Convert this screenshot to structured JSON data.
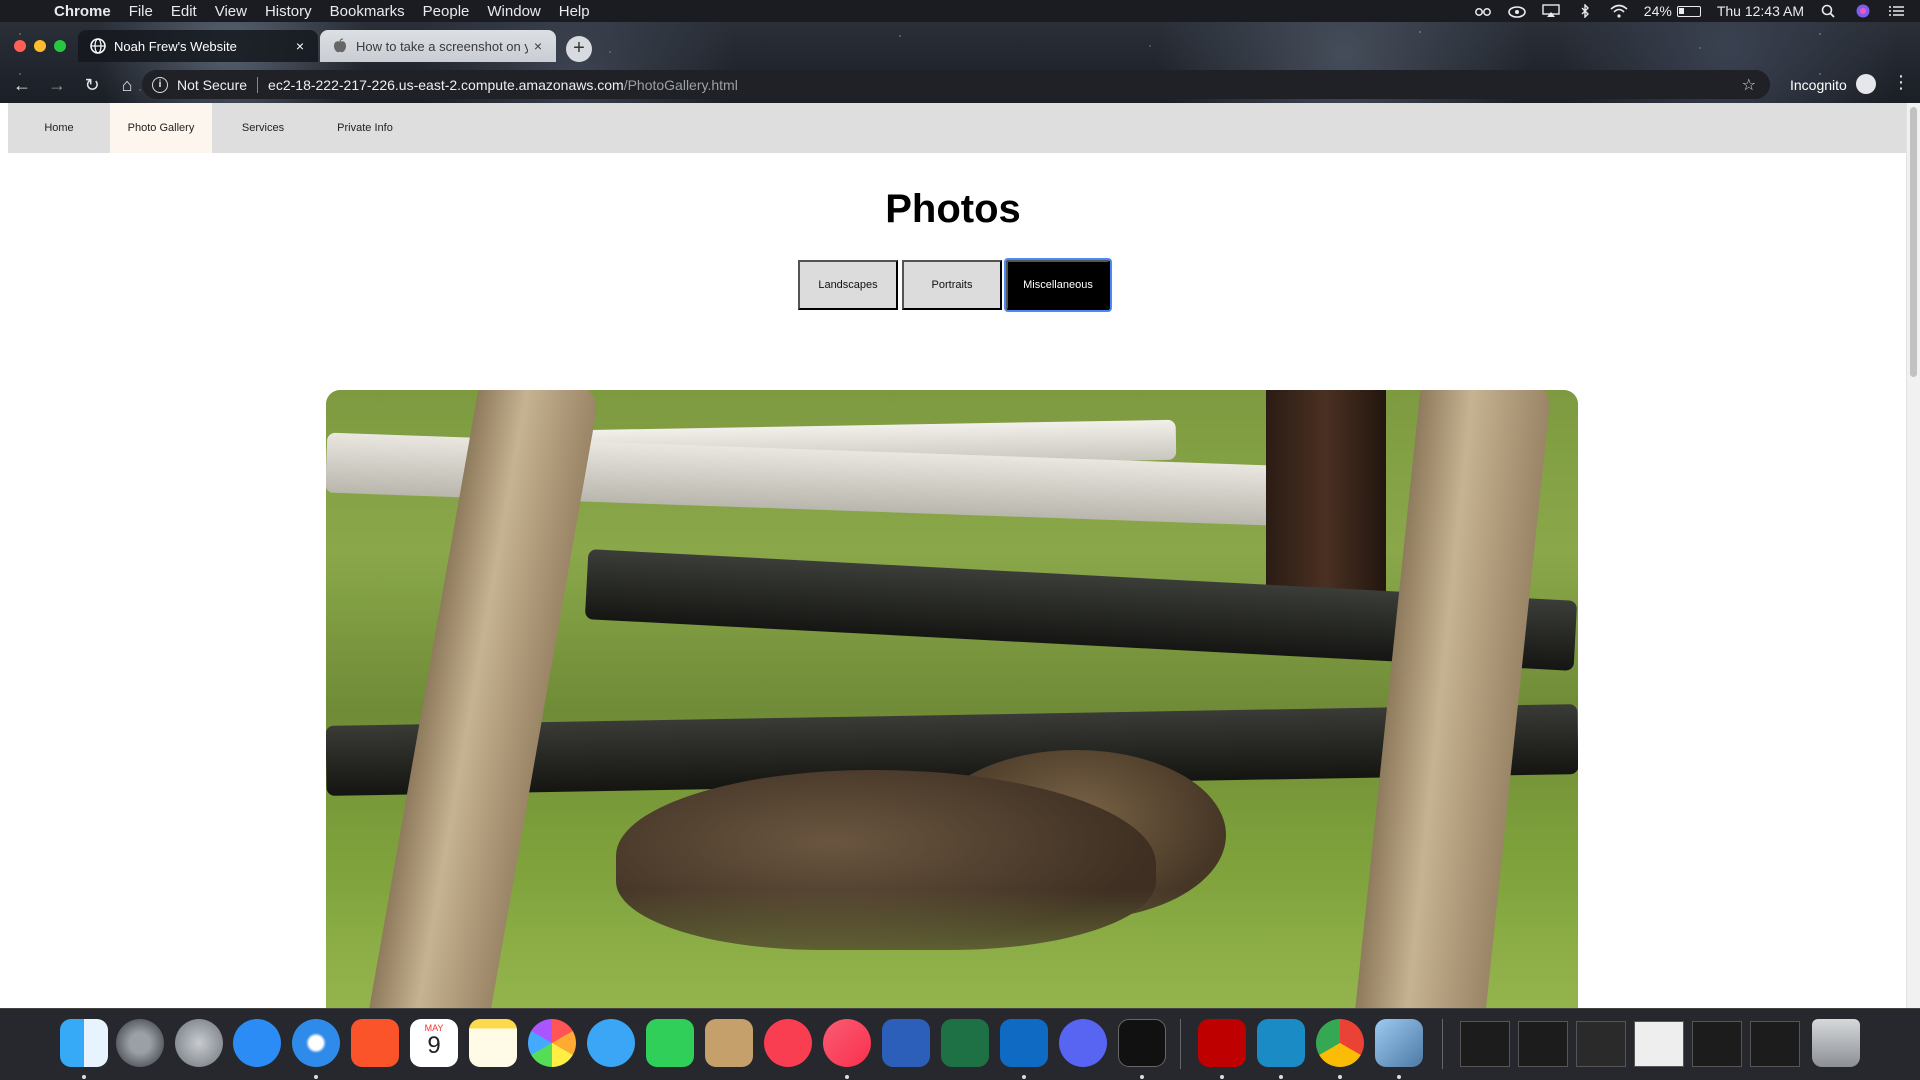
{
  "menubar": {
    "apple": "",
    "app": "Chrome",
    "menus": [
      "File",
      "Edit",
      "View",
      "History",
      "Bookmarks",
      "People",
      "Window",
      "Help"
    ],
    "battery": "24%",
    "clock": "Thu 12:43 AM"
  },
  "tabs": [
    {
      "title": "Noah Frew's Website",
      "close": "×"
    },
    {
      "title": "How to take a screenshot on yo",
      "close": "×"
    }
  ],
  "new_tab": "+",
  "toolbar": {
    "back": "←",
    "forward": "→",
    "reload": "↻",
    "home": "⌂",
    "security": "Not Secure",
    "url_host": "ec2-18-222-217-226.us-east-2.compute.amazonaws.com",
    "url_path": "/PhotoGallery.html",
    "star": "☆",
    "profile": "Incognito",
    "menu": "⋮"
  },
  "site": {
    "nav": [
      {
        "label": "Home",
        "active": false
      },
      {
        "label": "Photo Gallery",
        "active": true
      },
      {
        "label": "Services",
        "active": false
      },
      {
        "label": "Private Info",
        "active": false
      }
    ],
    "heading": "Photos",
    "filters": [
      {
        "label": "Landscapes",
        "selected": false
      },
      {
        "label": "Portraits",
        "selected": false
      },
      {
        "label": "Miscellaneous",
        "selected": true
      }
    ]
  },
  "dock": {
    "apps": [
      "finder",
      "system-preferences",
      "launchpad",
      "app-store",
      "safari",
      "brave",
      "calendar",
      "notes",
      "photos",
      "messages",
      "facetime",
      "contacts",
      "news",
      "music",
      "word",
      "excel",
      "outlook",
      "discord",
      "terminal",
      "filezilla",
      "citrix",
      "chrome",
      "preview"
    ],
    "calendar_month": "MAY",
    "calendar_day": "9"
  }
}
